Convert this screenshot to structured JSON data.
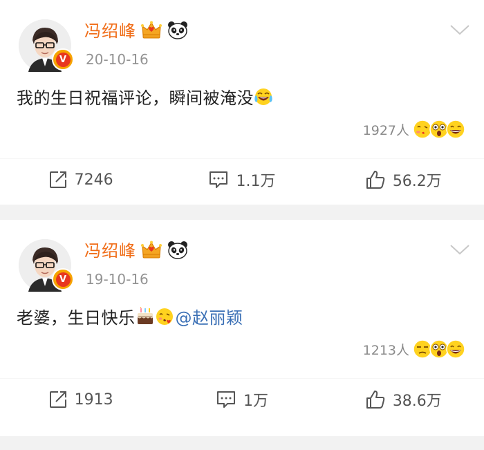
{
  "posts": [
    {
      "author": "冯绍峰",
      "date": "20-10-16",
      "text": "我的生日祝福评论，瞬间被淹没",
      "mention": "",
      "reaction_count": "1927人",
      "actions": {
        "repost": "7246",
        "comment": "1.1万",
        "like": "56.2万"
      }
    },
    {
      "author": "冯绍峰",
      "date": "19-10-16",
      "text": "老婆，生日快乐",
      "mention": "@赵丽颖",
      "reaction_count": "1213人",
      "actions": {
        "repost": "1913",
        "comment": "1万",
        "like": "38.6万"
      }
    }
  ],
  "colors": {
    "author_name": "#f06d18",
    "mention_link": "#3a6fb5",
    "verified_badge": "#e8361f"
  },
  "icons": {
    "verified": "verified-v-icon",
    "crown": "crown-badge-icon",
    "panda": "panda-badge-icon",
    "more": "chevron-down-icon",
    "repost": "repost-icon",
    "comment": "comment-icon",
    "like": "thumbs-up-icon"
  }
}
